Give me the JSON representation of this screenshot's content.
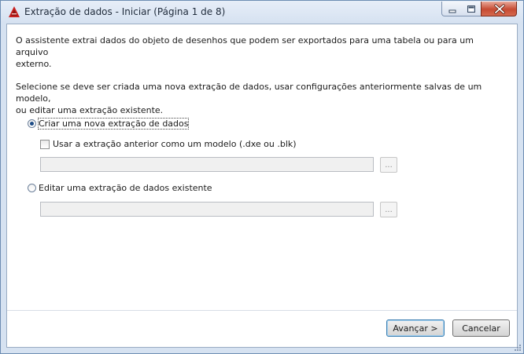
{
  "window": {
    "title": "Extração de dados - Iniciar (Página 1 de 8)"
  },
  "content": {
    "intro_text": "O assistente extrai dados do objeto de desenhos que podem ser exportados para uma tabela ou para um arquivo\nexterno.",
    "select_text": "Selecione se deve ser criada uma nova extração de dados, usar configurações anteriormente salvas de um modelo,\nou editar uma extração existente.",
    "options": {
      "create_new": {
        "label": "Criar uma nova extração de dados",
        "selected": true
      },
      "use_template": {
        "label": "Usar a extração anterior como um modelo (.dxe ou .blk)",
        "checked": false
      },
      "template_path": {
        "value": ""
      },
      "browse_template": {
        "label": "..."
      },
      "edit_existing": {
        "label": "Editar uma extração de dados existente",
        "selected": false
      },
      "existing_path": {
        "value": ""
      },
      "browse_existing": {
        "label": "..."
      }
    }
  },
  "footer": {
    "next_label": "Avançar >",
    "cancel_label": "Cancelar"
  },
  "colors": {
    "app_icon": "#c8201e",
    "default_button_border": "#3c7fb1",
    "radio_dot": "#1c4b86"
  },
  "icons": {
    "app": "autocad-logo-icon",
    "minimize": "minimize-icon",
    "maximize": "maximize-icon",
    "close": "close-icon"
  }
}
